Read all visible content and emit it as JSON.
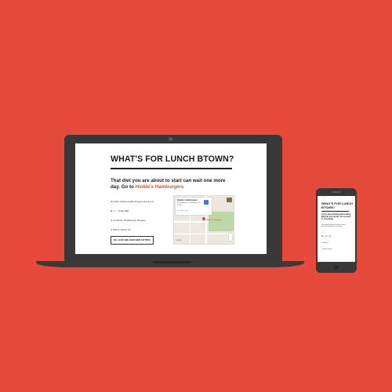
{
  "colors": {
    "background": "#e54a3a",
    "accent": "#e54a3a",
    "device_body": "#383838"
  },
  "laptop": {
    "title": "WHAT'S FOR LUNCH BTOWN?",
    "headline_pre": "That diet you are about to start can wait one more day. Go to ",
    "restaurant": "Hinkle's Hamburgers",
    "description": "No frills, classic quality burgers and lunch.",
    "price_active": "$",
    "price_inactive": "$$$",
    "price_note": "Under $10",
    "category": "American (Traditional), Burgers",
    "address": "206 S. Adams St.",
    "button": "NO, GIVE ME ANOTHER OPTION.",
    "map": {
      "card_title": "Hinkle's Hamburgers",
      "card_address": "206 S Adams St, Bloomington, IN 47403",
      "card_link": "View larger map",
      "pin_label": "Hinkle's Hamburgers",
      "attribution": "Google"
    }
  },
  "phone": {
    "title": "WHAT'S FOR LUNCH BTOWN?",
    "headline": "You've been thinking about eating Mexican food all day. Get on down to Casa Brava",
    "description": "Good quality authentic Mexican cuisine from fresh ingredients, every day.",
    "price_active": "$$",
    "price_inactive": "$$",
    "price_note": "$10 - $30",
    "category": "Mexican",
    "address": "Pride & Joy St."
  }
}
